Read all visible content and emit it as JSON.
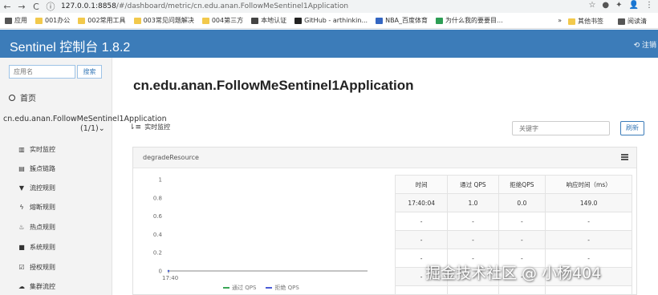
{
  "browser": {
    "url_host": "127.0.0.1:8858",
    "url_path": "/#/dashboard/metric/cn.edu.anan.FollowMeSentinel1Application",
    "bookmarks": [
      "应用",
      "001办公",
      "002常用工具",
      "003常见问题解决",
      "004第三方",
      "本地认证",
      "GitHub - arthinkin...",
      "NBA_百度体育",
      "为什么我的要要目..."
    ],
    "bookmark_more": "»",
    "bookmark_other": "其他书签",
    "bookmark_reading": "阅读清"
  },
  "header": {
    "title": "Sentinel 控制台 1.8.2",
    "logout": "注销",
    "brand_color": "#3c7cb9"
  },
  "sidebar": {
    "search_placeholder": "应用名",
    "search_button": "搜索",
    "home": "首页",
    "app_name": "cn.edu.anan.FollowMeSentinel1Application",
    "app_count": "(1/1)",
    "items": [
      "实时监控",
      "簇点链路",
      "流控规则",
      "熔断规则",
      "热点规则",
      "系统规则",
      "授权规则",
      "集群流控"
    ]
  },
  "main": {
    "title": "cn.edu.anan.FollowMeSentinel1Application",
    "realtime_label": "实时监控",
    "keyword_placeholder": "关键字",
    "refresh_button": "刷新",
    "panel_title": "degradeResource"
  },
  "chart_data": {
    "type": "line",
    "x": [
      "17:40"
    ],
    "series": [
      {
        "name": "通过 QPS",
        "values": [
          0
        ]
      },
      {
        "name": "拒绝 QPS",
        "values": [
          0
        ]
      }
    ],
    "yticks": [
      "1",
      "0.8",
      "0.6",
      "0.4",
      "0.2",
      "0"
    ],
    "ylim": [
      0,
      1
    ],
    "grid": false,
    "legend": "bottom",
    "colors": {
      "pass": "#3aa757",
      "block": "#4b5bd6"
    }
  },
  "table": {
    "headers": [
      "时间",
      "通过 QPS",
      "拒绝QPS",
      "响应时间（ms）"
    ],
    "rows": [
      [
        "17:40:04",
        "1.0",
        "0.0",
        "149.0"
      ],
      [
        "-",
        "-",
        "-",
        "-"
      ],
      [
        "-",
        "-",
        "-",
        "-"
      ],
      [
        "-",
        "-",
        "-",
        "-"
      ],
      [
        "-",
        "-",
        "-",
        "-"
      ],
      [
        "-",
        "-",
        "-",
        "-"
      ]
    ]
  },
  "watermark": "掘金技术社区 @ 小杨404"
}
